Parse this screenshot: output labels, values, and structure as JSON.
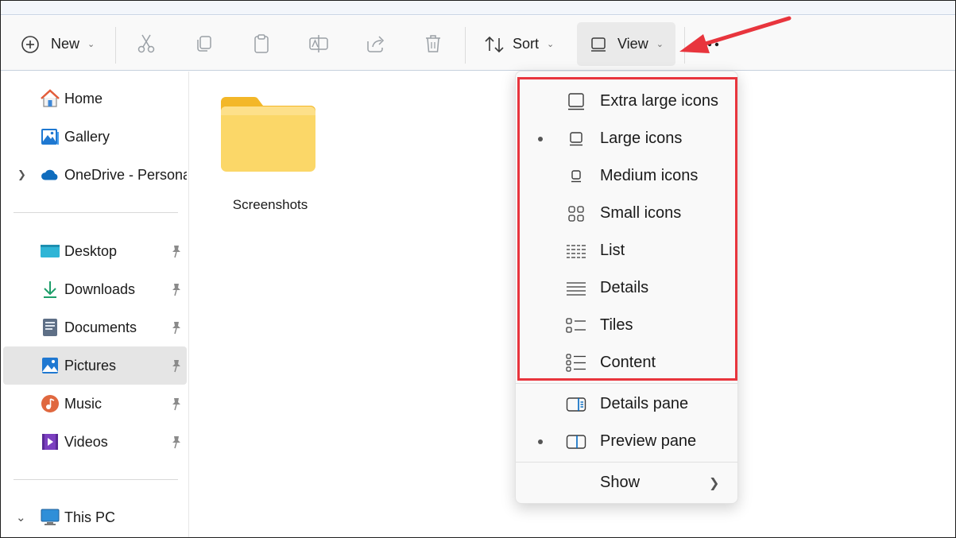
{
  "toolbar": {
    "new_label": "New",
    "sort_label": "Sort",
    "view_label": "View",
    "icons": [
      "cut-icon",
      "copy-icon",
      "paste-icon",
      "rename-icon",
      "share-icon",
      "delete-icon"
    ],
    "more_icon": "more-icon"
  },
  "sidebar": {
    "top_items": [
      {
        "label": "Home",
        "icon": "home-icon"
      },
      {
        "label": "Gallery",
        "icon": "gallery-icon"
      },
      {
        "label": "OneDrive - Personal",
        "icon": "onedrive-icon"
      }
    ],
    "pinned_items": [
      {
        "label": "Desktop",
        "icon": "desktop-icon"
      },
      {
        "label": "Downloads",
        "icon": "downloads-icon"
      },
      {
        "label": "Documents",
        "icon": "documents-icon"
      },
      {
        "label": "Pictures",
        "icon": "pictures-icon",
        "selected": true
      },
      {
        "label": "Music",
        "icon": "music-icon"
      },
      {
        "label": "Videos",
        "icon": "videos-icon"
      }
    ],
    "this_pc_label": "This PC"
  },
  "content": {
    "folders": [
      {
        "label": "Screenshots"
      }
    ]
  },
  "view_menu": {
    "layout_options": [
      {
        "label": "Extra large icons",
        "selected": false
      },
      {
        "label": "Large icons",
        "selected": true
      },
      {
        "label": "Medium icons",
        "selected": false
      },
      {
        "label": "Small icons",
        "selected": false
      },
      {
        "label": "List",
        "selected": false
      },
      {
        "label": "Details",
        "selected": false
      },
      {
        "label": "Tiles",
        "selected": false
      },
      {
        "label": "Content",
        "selected": false
      }
    ],
    "pane_options": [
      {
        "label": "Details pane",
        "selected": false
      },
      {
        "label": "Preview pane",
        "selected": true
      }
    ],
    "show_label": "Show"
  },
  "colors": {
    "accent": "#0067c0",
    "highlight": "#e8353d",
    "folder": "#f8c843"
  }
}
